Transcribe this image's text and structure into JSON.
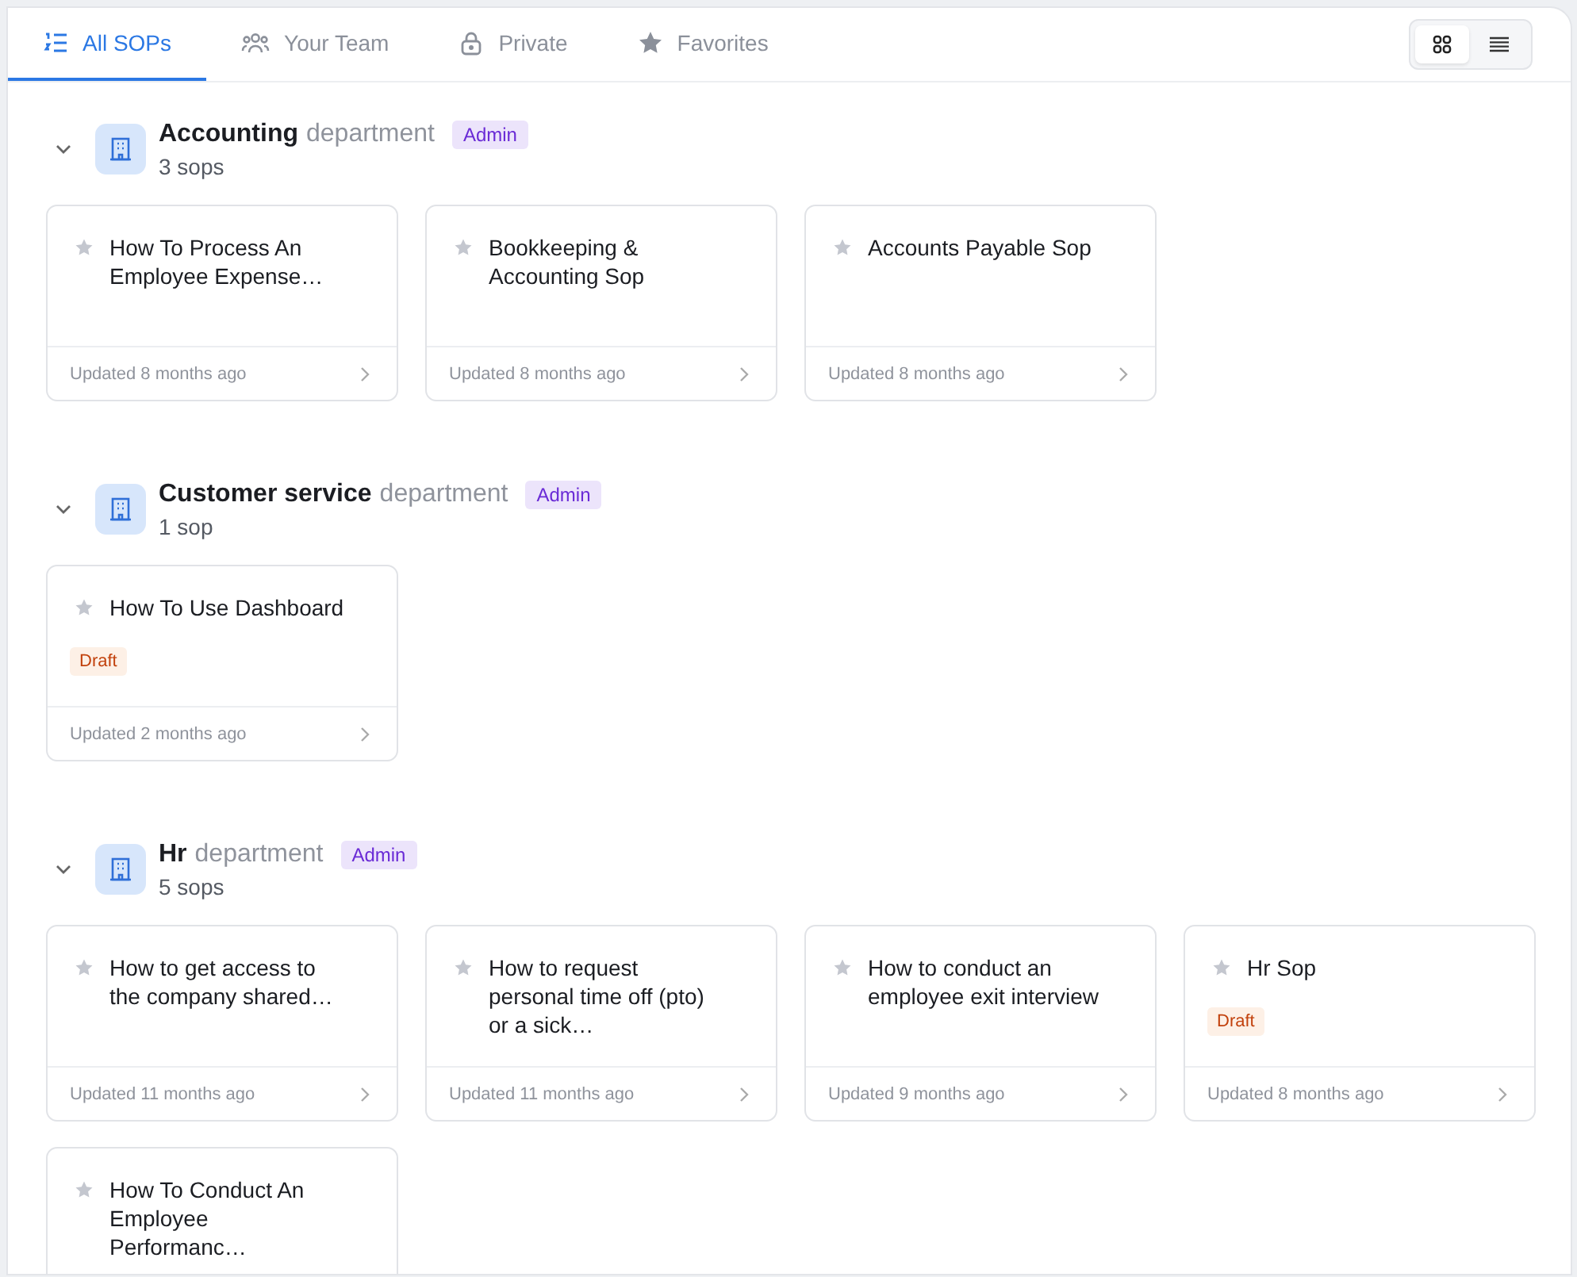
{
  "tabs": [
    {
      "label": "All SOPs",
      "kind": "list",
      "selected": true
    },
    {
      "label": "Your Team",
      "kind": "team",
      "selected": false
    },
    {
      "label": "Private",
      "kind": "lock",
      "selected": false
    },
    {
      "label": "Favorites",
      "kind": "star",
      "selected": false
    }
  ],
  "view_toggle": [
    {
      "kind": "grid",
      "selected": true
    },
    {
      "kind": "list",
      "selected": false
    }
  ],
  "departments": [
    {
      "name": "Accounting",
      "suffix": "department",
      "role": "Admin",
      "count": "3 sops",
      "expanded": true,
      "sops": [
        {
          "title": "How To Process An Employee Expense…",
          "favorite": false,
          "updated": "Updated 8 months ago"
        },
        {
          "title": "Bookkeeping & Accounting Sop",
          "favorite": false,
          "updated": "Updated 8 months ago"
        },
        {
          "title": "Accounts Payable Sop",
          "favorite": false,
          "updated": "Updated 8 months ago"
        }
      ]
    },
    {
      "name": "Customer service",
      "suffix": "department",
      "role": "Admin",
      "count": "1 sop",
      "expanded": true,
      "sops": [
        {
          "title": "How To Use Dashboard",
          "favorite": false,
          "badge": "Draft",
          "updated": "Updated 2 months ago"
        }
      ]
    },
    {
      "name": "Hr",
      "suffix": "department",
      "role": "Admin",
      "count": "5 sops",
      "expanded": true,
      "sops": [
        {
          "title": "How to get access to the company shared…",
          "favorite": false,
          "updated": "Updated 11 months ago"
        },
        {
          "title": "How to request personal time off (pto) or a sick…",
          "favorite": false,
          "updated": "Updated 11 months ago"
        },
        {
          "title": "How to conduct an employee exit interview",
          "favorite": false,
          "updated": "Updated 9 months ago"
        },
        {
          "title": "Hr Sop",
          "favorite": false,
          "badge": "Draft",
          "updated": "Updated 8 months ago"
        },
        {
          "title": "How To Conduct An Employee Performanc…",
          "favorite": false
        }
      ]
    }
  ]
}
